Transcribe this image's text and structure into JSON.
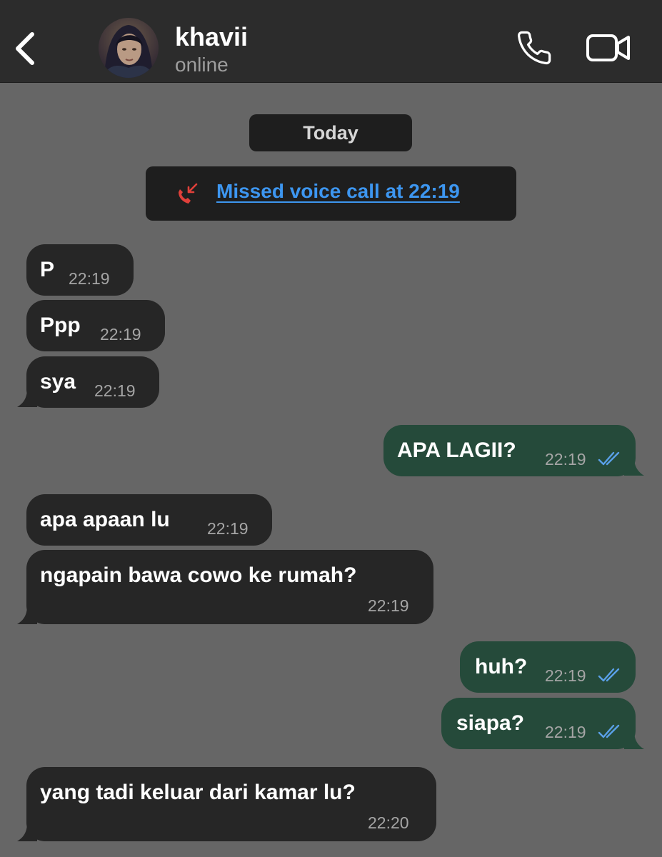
{
  "header": {
    "contact_name": "khavii",
    "status": "online"
  },
  "chat": {
    "date_label": "Today",
    "missed_call": "Missed voice call at 22:19",
    "messages": [
      {
        "side": "in",
        "text": "P",
        "time": "22:19"
      },
      {
        "side": "in",
        "text": "Ppp",
        "time": "22:19"
      },
      {
        "side": "in",
        "text": "sya",
        "time": "22:19"
      },
      {
        "side": "out",
        "text": "APA LAGII?",
        "time": "22:19",
        "read": true
      },
      {
        "side": "in",
        "text": "apa apaan lu",
        "time": "22:19"
      },
      {
        "side": "in",
        "text": "ngapain bawa cowo ke rumah?",
        "time": "22:19"
      },
      {
        "side": "out",
        "text": "huh?",
        "time": "22:19",
        "read": true
      },
      {
        "side": "out",
        "text": "siapa?",
        "time": "22:19",
        "read": true
      },
      {
        "side": "in",
        "text": "yang tadi keluar dari kamar lu?",
        "time": "22:20"
      }
    ]
  },
  "colors": {
    "header_bg": "#2c2c2c",
    "chat_bg": "#666666",
    "incoming_bubble": "#262626",
    "outgoing_bubble": "#254a3a",
    "link_blue": "#3d96f0",
    "missed_call_red": "#e0403a",
    "read_ticks": "#5aa0e8"
  },
  "icons": [
    "back-chevron-icon",
    "avatar",
    "phone-icon",
    "video-camera-icon",
    "missed-call-icon",
    "read-ticks-icon"
  ]
}
